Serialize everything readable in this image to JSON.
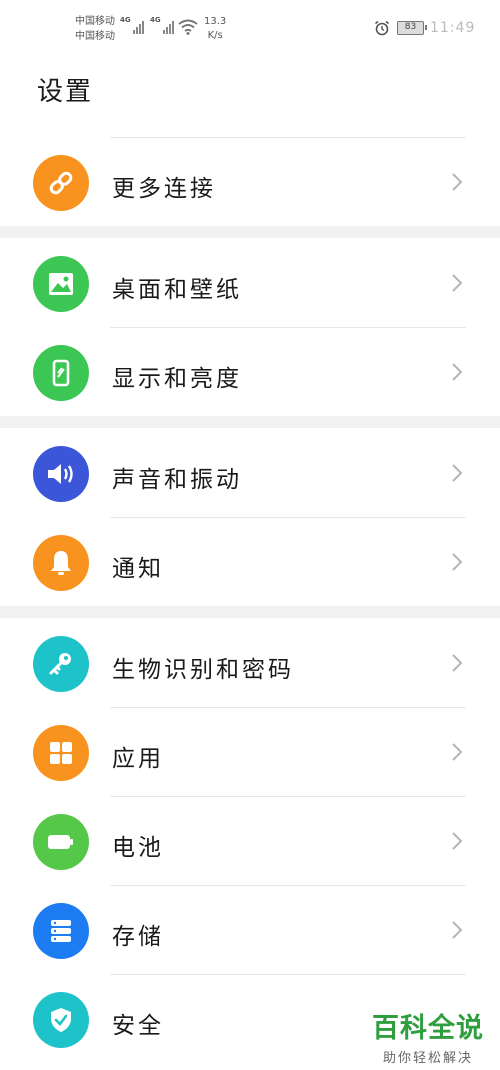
{
  "status_bar": {
    "carrier_1": "中国移动",
    "carrier_2": "中国移动",
    "network_1": "4G",
    "network_2": "4G",
    "speed_value": "13.3",
    "speed_unit": "K/s",
    "battery_level": "83",
    "time": "11:49"
  },
  "page": {
    "title": "设置"
  },
  "settings": {
    "items": [
      {
        "label": "更多连接",
        "icon": "link-icon",
        "color": "#f7931e"
      },
      {
        "label": "桌面和壁纸",
        "icon": "image-icon",
        "color": "#3cc653"
      },
      {
        "label": "显示和亮度",
        "icon": "phone-brightness-icon",
        "color": "#3cc653"
      },
      {
        "label": "声音和振动",
        "icon": "speaker-icon",
        "color": "#3b56d9"
      },
      {
        "label": "通知",
        "icon": "bell-icon",
        "color": "#f7931e"
      },
      {
        "label": "生物识别和密码",
        "icon": "key-icon",
        "color": "#1ec3c9"
      },
      {
        "label": "应用",
        "icon": "apps-grid-icon",
        "color": "#f7931e"
      },
      {
        "label": "电池",
        "icon": "battery-icon",
        "color": "#55c84a"
      },
      {
        "label": "存储",
        "icon": "storage-icon",
        "color": "#1d7cf2"
      },
      {
        "label": "安全",
        "icon": "shield-check-icon",
        "color": "#1ec3c9"
      }
    ]
  },
  "watermark": {
    "brand": "百科全说",
    "slogan": "助你轻松解决"
  }
}
